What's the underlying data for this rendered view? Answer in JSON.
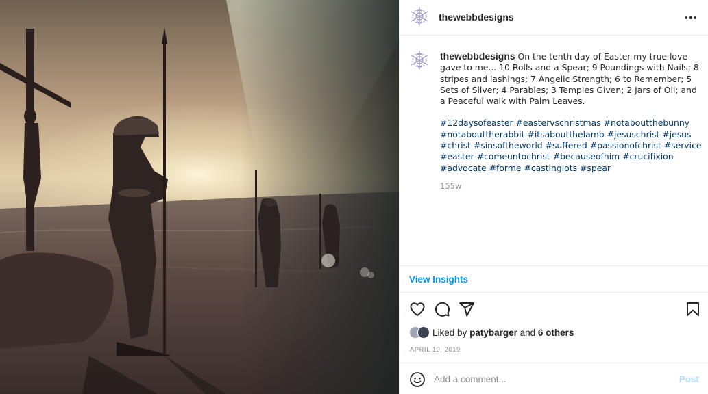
{
  "post": {
    "username": "thewebbdesigns",
    "caption": "On the tenth day of Easter my true love gave to me... 10 Rolls and a Spear; 9 Poundings with Nails; 8 stripes and lashings; 7 Angelic Strength; 6 to Remember; 5 Sets of Silver; 4 Parables; 3 Temples Given; 2 Jars of Oil; and a Peaceful walk with Palm Leaves.",
    "hashtags": [
      "#12daysofeaster",
      "#eastervschristmas",
      "#notaboutthebunny",
      "#notabouttherabbit",
      "#itsaboutthelamb",
      "#jesuschrist",
      "#jesus",
      "#christ",
      "#sinsoftheworld",
      "#suffered",
      "#passionofchrist",
      "#service",
      "#easter",
      "#comeuntochrist",
      "#becauseofhim",
      "#crucifixion",
      "#advocate",
      "#forme",
      "#castinglots",
      "#spear"
    ],
    "age": "155w",
    "date": "APRIL 19, 2019"
  },
  "insights": {
    "label": "View Insights"
  },
  "actions": {
    "like": "heart-icon",
    "comment": "comment-icon",
    "share": "share-icon",
    "save": "bookmark-icon"
  },
  "likes": {
    "prefix": "Liked by",
    "user": "patybarger",
    "and": "and",
    "others": "6 others"
  },
  "comment_box": {
    "placeholder": "Add a comment...",
    "post_label": "Post"
  },
  "colors": {
    "link": "#00376b",
    "accent": "#0095f6",
    "muted": "#8e8e8e",
    "post_disabled": "#b2dffc"
  }
}
